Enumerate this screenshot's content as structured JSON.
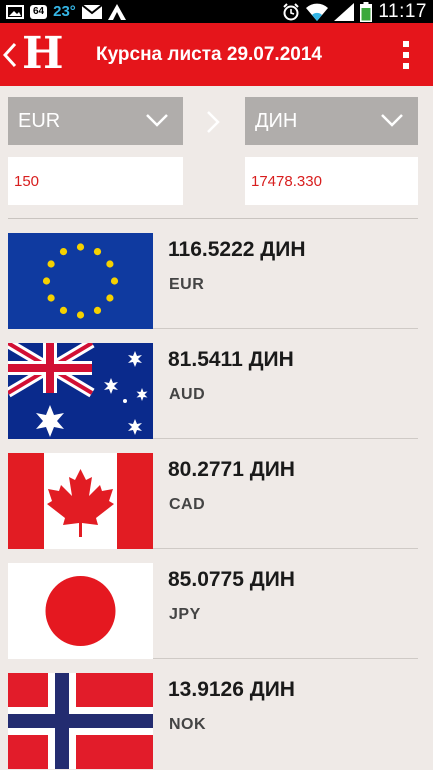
{
  "status_bar": {
    "badge": "64",
    "temperature": "23°",
    "time": "11:17"
  },
  "app_bar": {
    "logo": "H",
    "title": "Курсна листа 29.07.2014"
  },
  "converter": {
    "from_currency": "EUR",
    "to_currency": "ДИН",
    "from_amount": "150",
    "to_amount": "17478.330"
  },
  "rates": [
    {
      "value": "116.5222 ДИН",
      "code": "EUR",
      "flag": "eu-flag"
    },
    {
      "value": "81.5411 ДИН",
      "code": "AUD",
      "flag": "australia-flag"
    },
    {
      "value": "80.2771 ДИН",
      "code": "CAD",
      "flag": "canada-flag"
    },
    {
      "value": "85.0775 ДИН",
      "code": "JPY",
      "flag": "japan-flag"
    },
    {
      "value": "13.9126 ДИН",
      "code": "NOK",
      "flag": "norway-flag"
    }
  ],
  "colors": {
    "app_bar": "#e5151b",
    "background": "#efeae7",
    "select_bg": "#b0adab",
    "amount_text": "#d81e1e"
  }
}
